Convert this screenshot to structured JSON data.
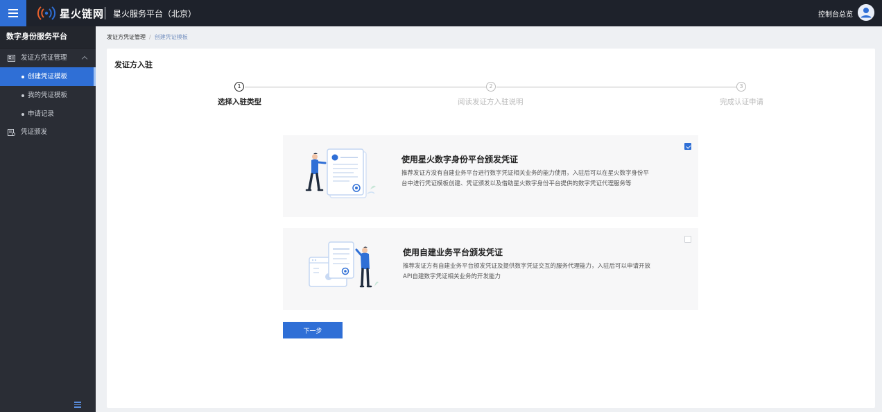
{
  "header": {
    "logo_text": "星火链网",
    "platform_title": "星火服务平台（北京）",
    "console_link": "控制台总览"
  },
  "sidebar": {
    "title": "数字身份服务平台",
    "groups": [
      {
        "label": "发证方凭证管理",
        "icon": "certificate-management-icon",
        "expanded": true,
        "items": [
          {
            "label": "创建凭证模板",
            "active": true
          },
          {
            "label": "我的凭证模板",
            "active": false
          },
          {
            "label": "申请记录",
            "active": false
          }
        ]
      },
      {
        "label": "凭证颁发",
        "icon": "issue-certificate-icon"
      }
    ]
  },
  "breadcrumb": {
    "parent": "发证方凭证管理",
    "separator": "/",
    "current": "创建凭证模板"
  },
  "panel": {
    "title": "发证方入驻"
  },
  "steps": [
    {
      "number": "1",
      "label": "选择入驻类型",
      "active": true
    },
    {
      "number": "2",
      "label": "阅读发证方入驻说明",
      "active": false
    },
    {
      "number": "3",
      "label": "完成认证申请",
      "active": false
    }
  ],
  "options": [
    {
      "title": "使用星火数字身份平台颁发凭证",
      "desc_line1": "推荐发证方没有自建业务平台进行数字凭证相关业务的能力使用，入驻后可以在星火数字身份平",
      "desc_line2": "台中进行凭证模板创建、凭证颁发以及借助星火数字身份平台提供的数字凭证代理服务等",
      "checked": true
    },
    {
      "title": "使用自建业务平台颁发凭证",
      "desc_line1": "推荐发证方有自建业务平台颁发凭证及提供数字凭证交互的服务代理能力，入驻后可以申请开放",
      "desc_line2": "API自建数字凭证相关业务的开发能力",
      "checked": false
    }
  ],
  "actions": {
    "next_label": "下一步"
  },
  "colors": {
    "primary": "#2f6fd6",
    "topbar": "#1e222b",
    "sidebar": "#2a2d35",
    "logo_accent": "#e8612c"
  }
}
